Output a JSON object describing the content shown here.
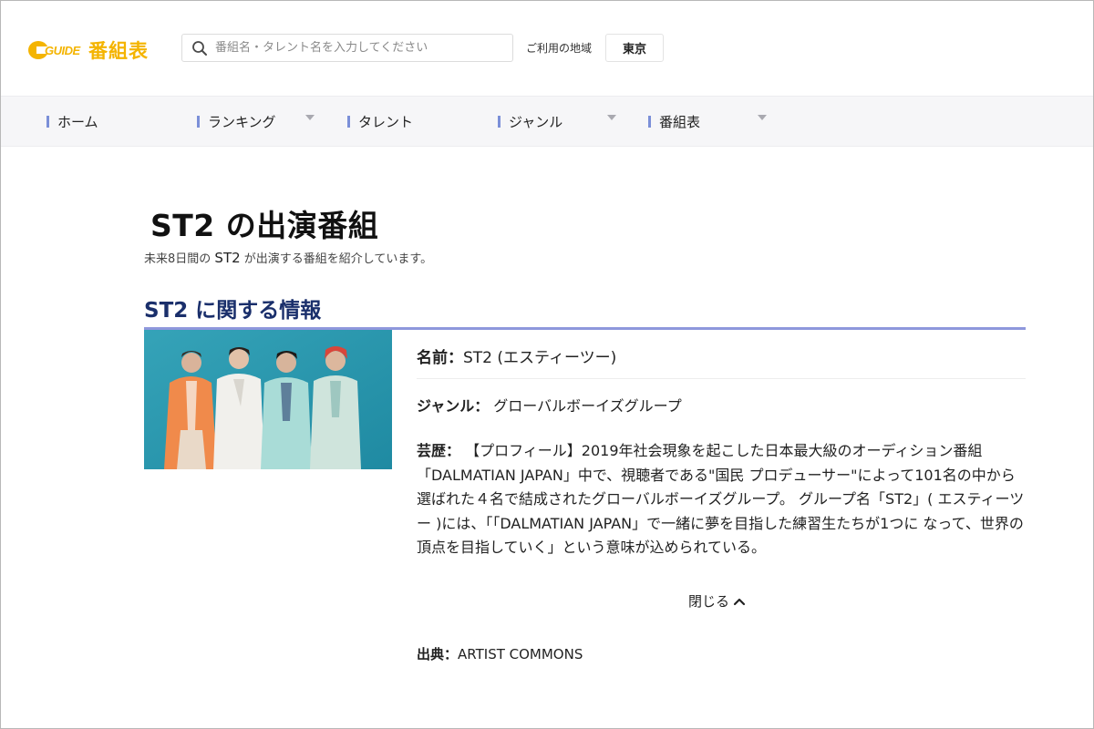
{
  "header": {
    "logo_guide": "GUIDE",
    "logo_text": "番組表",
    "search_placeholder": "番組名・タレント名を入力してください",
    "region_label": "ご利用の地域",
    "region_value": "東京"
  },
  "nav": {
    "items": [
      {
        "label": "ホーム"
      },
      {
        "label": "ランキング"
      },
      {
        "label": "タレント"
      },
      {
        "label": "ジャンル"
      },
      {
        "label": "番組表"
      }
    ]
  },
  "main": {
    "title": "ST2 の出演番組",
    "subtitle_pre": "未来8日間の",
    "subtitle_name": "ST2",
    "subtitle_post": "が出演する番組を紹介しています。",
    "section_title": "ST2 に関する情報"
  },
  "info": {
    "name_label": "名前：",
    "name_value": "ST2 (エスティーツー)",
    "genre_label": "ジャンル：",
    "genre_value": "グローバルボーイズグループ",
    "profile_label": "芸歴：",
    "profile_value": "【プロフィール】2019年社会現象を起こした日本最大級のオーディション番組「DALMATIAN JAPAN」中で、視聴者である\"国民 プロデューサー\"によって101名の中から選ばれた４名で結成されたグローバルボーイズグループ。 グループ名「ST2」( エスティーツー )には、「「DALMATIAN JAPAN」で一緒に夢を目指した練習生たちが1つに なって、世界の頂点を目指していく」という意味が込められている。",
    "close_label": "閉じる",
    "source_label": "出典：",
    "source_value": "ARTIST COMMONS"
  },
  "colors": {
    "brand": "#f4b400",
    "heading_navy": "#1a2f6b",
    "accent_rule": "#8e97dc",
    "nav_bar": "#7b8fd8",
    "photo_bg": "#2a97ae"
  },
  "icons": {
    "search": "search-icon",
    "caret": "chevron-down-icon",
    "close": "chevron-up-icon"
  }
}
